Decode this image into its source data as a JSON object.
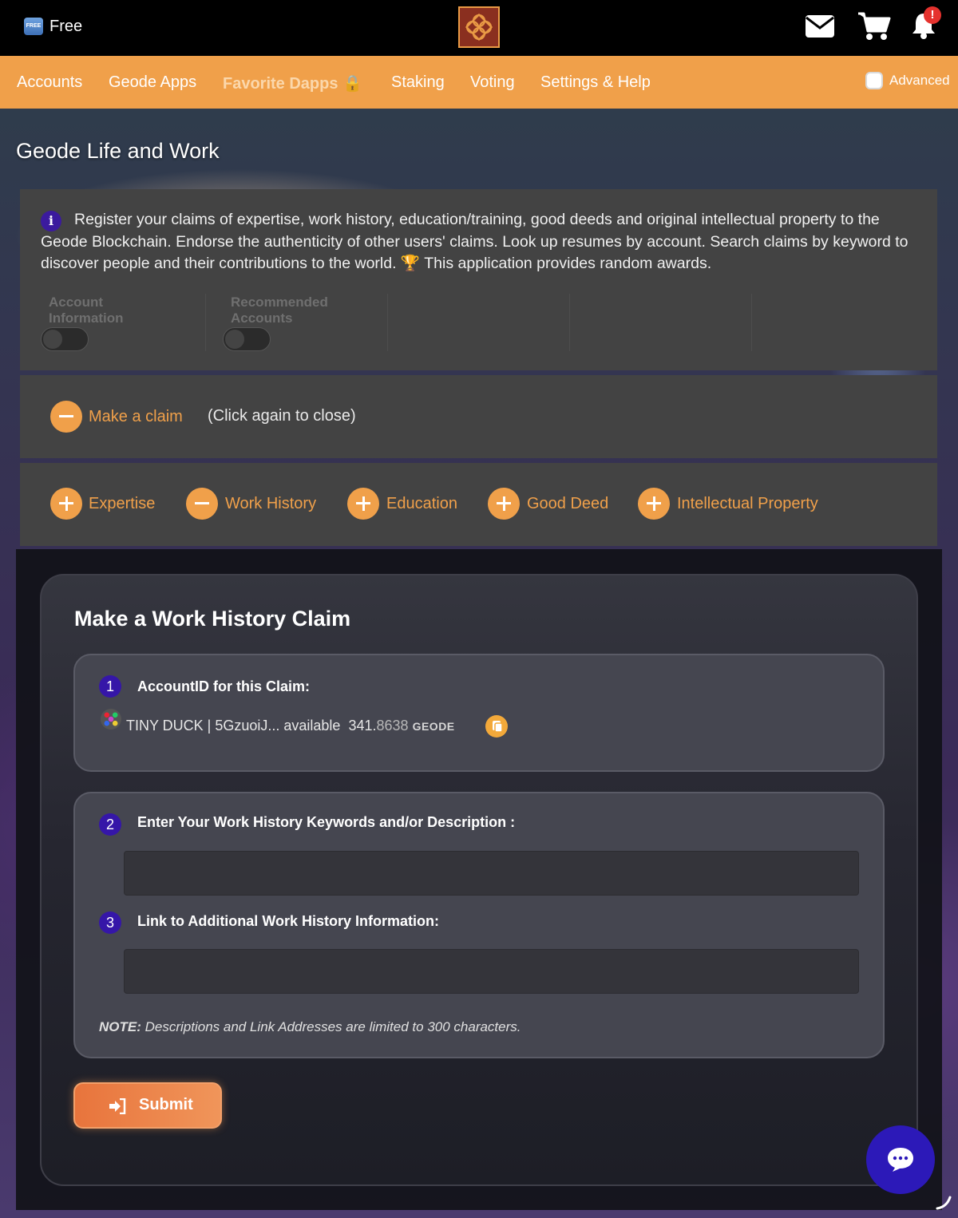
{
  "topbar": {
    "badge_text": "FREE",
    "free_label": "Free",
    "notification_count": "!",
    "logo": "geode-logo",
    "icons": [
      "mail-icon",
      "cart-icon",
      "bell-icon"
    ]
  },
  "nav": {
    "items": [
      "Accounts",
      "Geode Apps",
      "Favorite Dapps",
      "Staking",
      "Voting",
      "Settings & Help"
    ],
    "favorite_emoji": "🔒",
    "advanced_label": "Advanced",
    "advanced_checked": false,
    "color": "#f0a04a"
  },
  "page": {
    "title": "Geode Life and Work"
  },
  "info": {
    "text": "Register your claims of expertise, work history, education/training, good deeds and original intellectual property to the Geode Blockchain. Endorse the authenticity of other users' claims. Look up resumes by account. Search claims by keyword to discover people and their contributions to the world. 🏆 This application provides random awards.",
    "toggles": [
      {
        "label": "Account Information",
        "on": false
      },
      {
        "label": "Recommended Accounts",
        "on": false
      }
    ]
  },
  "make_claim": {
    "label": "Make a claim",
    "hint": "(Click again to close)",
    "open": true
  },
  "claim_types": [
    {
      "label": "Expertise",
      "open": false
    },
    {
      "label": "Work History",
      "open": true
    },
    {
      "label": "Education",
      "open": false
    },
    {
      "label": "Good Deed",
      "open": false
    },
    {
      "label": "Intellectual Property",
      "open": false
    }
  ],
  "form": {
    "title": "Make a Work History Claim",
    "step1": {
      "num": "1",
      "label": "AccountID for this Claim:",
      "account_text": "TINY DUCK | 5GzuoiJ... available",
      "balance_main": "341.",
      "balance_frac": "8638",
      "unit": "GEODE"
    },
    "step2": {
      "num": "2",
      "label": "Enter Your Work History Keywords and/or Description :",
      "value": ""
    },
    "step3": {
      "num": "3",
      "label": "Link to Additional Work History Information:",
      "value": ""
    },
    "note_bold": "NOTE:",
    "note_text": " Descriptions and Link Addresses are limited to 300 characters.",
    "submit_label": "Submit"
  },
  "chat": {
    "icon": "chat-bubble-icon",
    "color": "#2c19b8"
  }
}
